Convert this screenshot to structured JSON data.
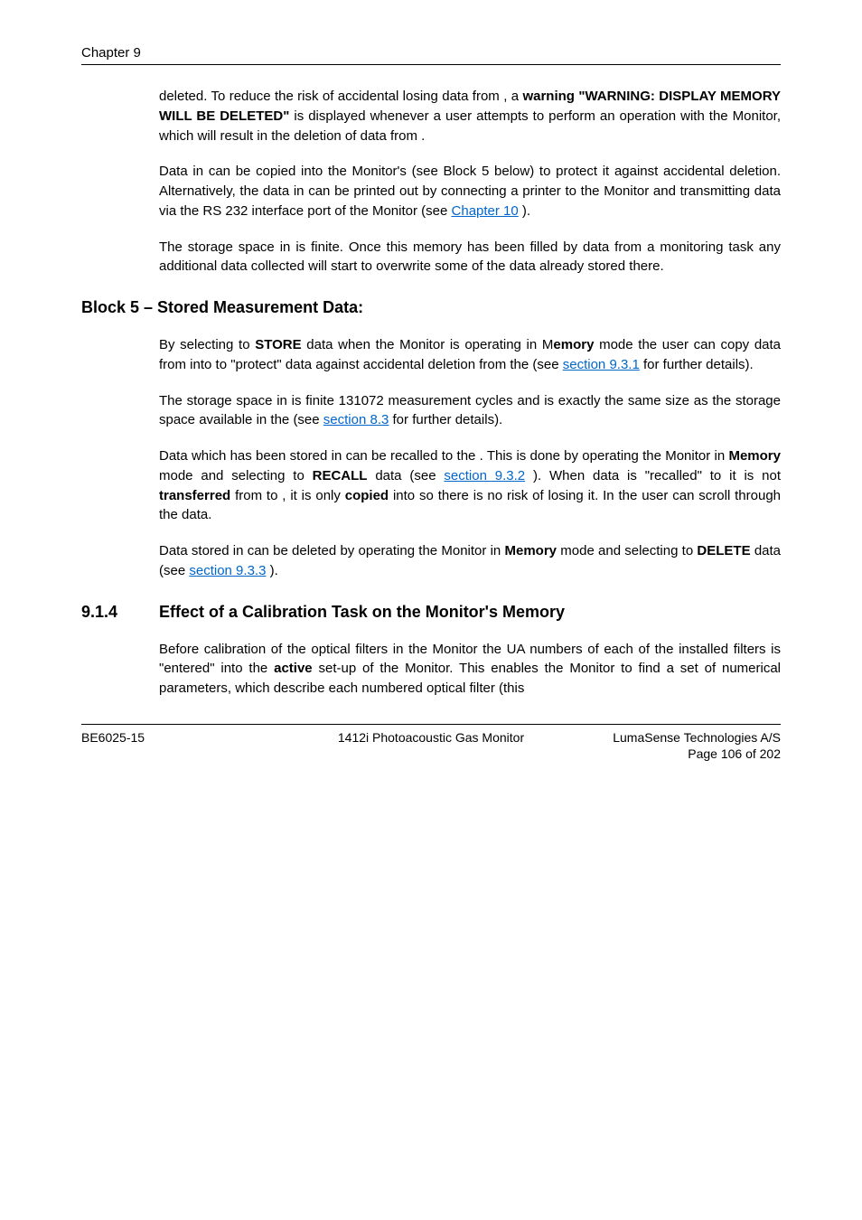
{
  "header": {
    "chapter": "Chapter 9"
  },
  "p1": {
    "t1": "deleted. To reduce the risk of accidental losing data from ",
    "t2": ", a ",
    "t3": "warning \"WARNING: DISPLAY MEMORY WILL BE DELETED\"",
    "t4": " is displayed whenever a user attempts to perform an operation with the Monitor, which will result in the deletion of data from ",
    "t5": "."
  },
  "p2": {
    "t1": "Data in ",
    "t2": " can be copied into the Monitor's ",
    "t3": " (see Block 5 below) to protect it against accidental deletion. Alternatively, the data in ",
    "t4": " can be printed out by connecting a printer to the Monitor and transmitting data via the RS 232 interface port of the Monitor (see ",
    "link": "Chapter 10",
    "t5": ")."
  },
  "p3": {
    "t1": "The storage space in ",
    "t2": " is finite. Once this memory has been filled by data from a monitoring task any additional data collected will start to overwrite some of the data already stored there."
  },
  "block5": {
    "title": "Block 5 – Stored Measurement Data:"
  },
  "p4": {
    "t1": "By selecting to ",
    "store": "STORE",
    "t2": " data when the Monitor is operating in M",
    "emory": "emory",
    "t3": " mode the user can copy data from ",
    "t4": " into ",
    "t5": " to \"protect\" data against accidental deletion from the ",
    "t6": " (see ",
    "link": "section 9.3.1",
    "t7": " for further details)."
  },
  "p5": {
    "t1": "The storage space in ",
    "t2": " is finite 131072 measurement cycles and is exactly the same size as the storage space available in the ",
    "t3": " (see ",
    "link": "section 8.3",
    "t4": " for further details)."
  },
  "p6": {
    "t1": "Data which has been stored in ",
    "t2": " can be recalled to the ",
    "t3": ". This is done by operating the Monitor in ",
    "memory": "Memory",
    "t4": " mode and selecting to ",
    "recall": "RECALL",
    "t5": " data (see ",
    "link": "section 9.3.2",
    "t6": "). When data is \"recalled\" to ",
    "t7": " it is not ",
    "transferred": "transferred",
    "t8": " from ",
    "t9": " to ",
    "t10": ", it is only ",
    "copied": "copied",
    "t11": " into ",
    "t12": " so there is no risk of losing it. In ",
    "t13": " the user can scroll through the data."
  },
  "p7": {
    "t1": "Data stored in ",
    "t2": " can be deleted by operating the Monitor in ",
    "memory": "Memory",
    "t3": " mode and selecting to ",
    "delete": "DELETE",
    "t4": " data (see ",
    "link": "section 9.3.3",
    "t5": ")."
  },
  "sec914": {
    "num": "9.1.4",
    "title": "Effect of a Calibration Task on the Monitor's Memory"
  },
  "p8": {
    "t1": "Before calibration of the optical filters in the Monitor the UA numbers of each of the installed filters is \"entered\" into the ",
    "active": "active",
    "t2": " set-up of the Monitor. This enables the Monitor to find a set of numerical parameters, which describe each numbered optical filter (this"
  },
  "footer": {
    "left": "BE6025-15",
    "center": "1412i Photoacoustic Gas Monitor",
    "right": "LumaSense Technologies A/S",
    "page": "Page 106 of 202"
  }
}
